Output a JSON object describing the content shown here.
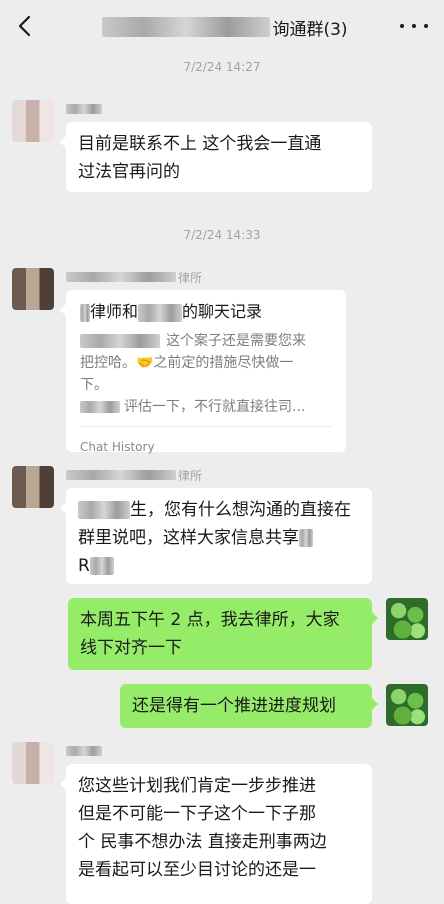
{
  "header": {
    "title_suffix": "询通群(3)",
    "back_icon": "chevron-left-icon",
    "more_icon": "more-dots-icon"
  },
  "timestamps": [
    "7/2/24 14:27",
    "7/2/24 14:33"
  ],
  "messages": [
    {
      "side": "left",
      "text_line1": "目前是联系不上 这个我会一直通",
      "text_line2": "过法官再问的"
    },
    {
      "side": "left",
      "sender_suffix": "律所",
      "type": "chat-history-card",
      "title_mid": "律师和",
      "title_end": "的聊天记录",
      "line1": "这个案子还是需要您来",
      "line2a": "把控哈。",
      "emoji": "🤝",
      "line2b": "之前定的措施尽快做一",
      "line3": "下。",
      "line4": "评估一下，不行就直接往司...",
      "footer": "Chat History"
    },
    {
      "side": "left",
      "sender_suffix": "律所",
      "line1a": "生，您有什么想沟通的直接在",
      "line2": "群里说吧，这样大家信息共享",
      "line3a": "R"
    },
    {
      "side": "right",
      "line1": "本周五下午 2 点，我去律所，大家",
      "line2": "线下对齐一下"
    },
    {
      "side": "right",
      "text": "还是得有一个推进进度规划"
    },
    {
      "side": "left",
      "line1": "您这些计划我们肯定一步步推进",
      "line2": "但是不可能一下子这个一下子那",
      "line3": "个 民事不想办法 直接走刑事两边",
      "line4": "是看起可以至少目讨论的还是一"
    }
  ]
}
